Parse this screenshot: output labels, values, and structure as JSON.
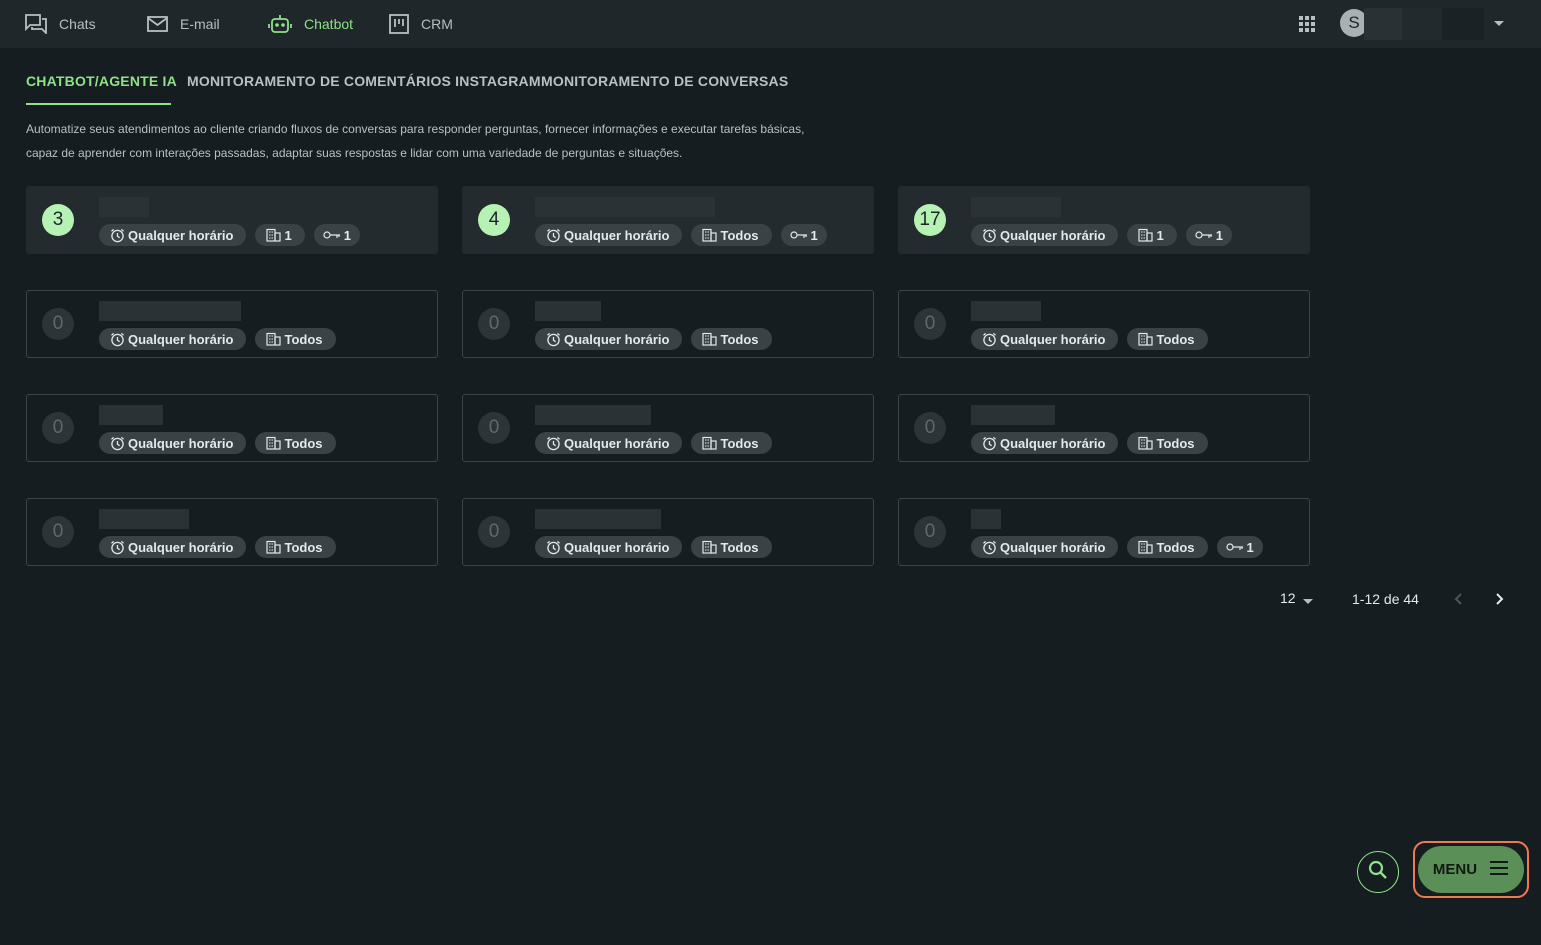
{
  "nav": {
    "items": [
      {
        "label": "Chats",
        "icon": "chat-bubbles-icon"
      },
      {
        "label": "E-mail",
        "icon": "mail-icon"
      },
      {
        "label": "Chatbot",
        "icon": "robot-icon"
      },
      {
        "label": "CRM",
        "icon": "kanban-icon"
      }
    ],
    "active": "Chatbot",
    "avatar_initial": "S"
  },
  "tabs": [
    {
      "label": "CHATBOT/AGENTE IA"
    },
    {
      "label": "MONITORAMENTO DE COMENTÁRIOS INSTAGRAM"
    },
    {
      "label": "MONITORAMENTO DE CONVERSAS"
    }
  ],
  "active_tab": "CHATBOT/AGENTE IA",
  "description": {
    "line1": "Automatize seus atendimentos ao cliente criando fluxos de conversas para responder perguntas, fornecer informações e executar tarefas básicas,",
    "line2": "capaz de aprender com interações passadas, adaptar suas respostas e lidar com uma variedade de perguntas e situações."
  },
  "bots": [
    {
      "count": "3",
      "schedule": "Qualquer horário",
      "departments": "1",
      "keys": "1"
    },
    {
      "count": "4",
      "schedule": "Qualquer horário",
      "departments": "Todos",
      "keys": "1"
    },
    {
      "count": "17",
      "schedule": "Qualquer horário",
      "departments": "1",
      "keys": "1"
    },
    {
      "count": "0",
      "schedule": "Qualquer horário",
      "departments": "Todos"
    },
    {
      "count": "0",
      "schedule": "Qualquer horário",
      "departments": "Todos"
    },
    {
      "count": "0",
      "schedule": "Qualquer horário",
      "departments": "Todos"
    },
    {
      "count": "0",
      "schedule": "Qualquer horário",
      "departments": "Todos"
    },
    {
      "count": "0",
      "schedule": "Qualquer horário",
      "departments": "Todos"
    },
    {
      "count": "0",
      "schedule": "Qualquer horário",
      "departments": "Todos"
    },
    {
      "count": "0",
      "schedule": "Qualquer horário",
      "departments": "Todos"
    },
    {
      "count": "0",
      "schedule": "Qualquer horário",
      "departments": "Todos"
    },
    {
      "count": "0",
      "schedule": "Qualquer horário",
      "departments": "Todos",
      "keys": "1"
    }
  ],
  "pagination": {
    "per_page": "12",
    "range": "1-12 de 44"
  },
  "menu_button": {
    "label": "MENU"
  },
  "colors": {
    "accent": "#8ee28a",
    "background": "#161d20",
    "topbar": "#20272a",
    "menu_button": "#5a8f57",
    "highlight_outline": "#f07a4f"
  }
}
